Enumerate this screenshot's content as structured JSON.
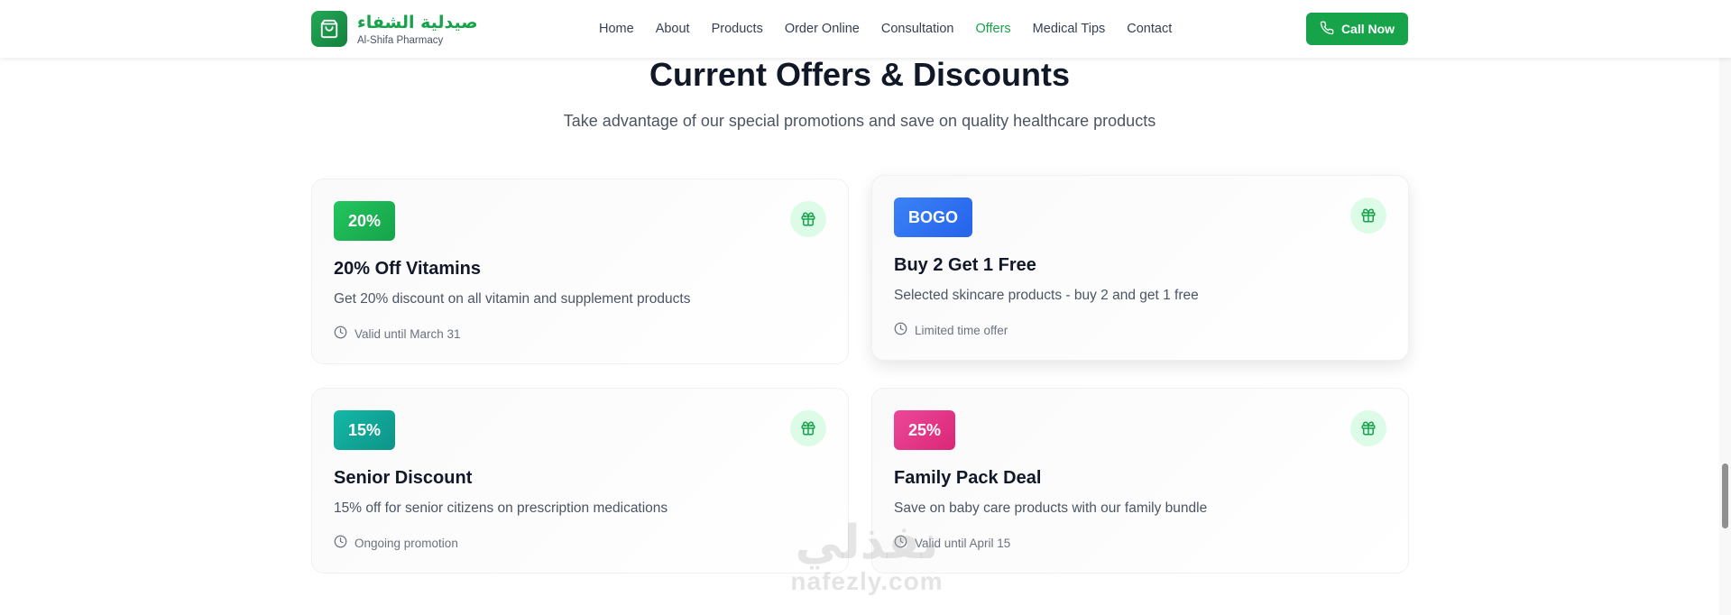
{
  "header": {
    "brand_arabic": "صيدلية الشفاء",
    "brand_english": "Al-Shifa Pharmacy",
    "nav": [
      {
        "label": "Home",
        "active": false
      },
      {
        "label": "About",
        "active": false
      },
      {
        "label": "Products",
        "active": false
      },
      {
        "label": "Order Online",
        "active": false
      },
      {
        "label": "Consultation",
        "active": false
      },
      {
        "label": "Offers",
        "active": true
      },
      {
        "label": "Medical Tips",
        "active": false
      },
      {
        "label": "Contact",
        "active": false
      }
    ],
    "call_button": "Call Now"
  },
  "section": {
    "title": "Current Offers & Discounts",
    "subtitle": "Take advantage of our special promotions and save on quality healthcare products"
  },
  "offers": [
    {
      "badge": "20%",
      "badge_color": "#16a34a",
      "title": "20% Off Vitamins",
      "description": "Get 20% discount on all vitamin and supplement products",
      "validity": "Valid until March 31"
    },
    {
      "badge": "BOGO",
      "badge_color": "#2563eb",
      "title": "Buy 2 Get 1 Free",
      "description": "Selected skincare products - buy 2 and get 1 free",
      "validity": "Limited time offer"
    },
    {
      "badge": "15%",
      "badge_color": "#0d9488",
      "title": "Senior Discount",
      "description": "15% off for senior citizens on prescription medications",
      "validity": "Ongoing promotion"
    },
    {
      "badge": "25%",
      "badge_color": "#db2777",
      "title": "Family Pack Deal",
      "description": "Save on baby care products with our family bundle",
      "validity": "Valid until April 15"
    }
  ],
  "watermark": {
    "arabic": "نفذلي",
    "english": "nafezly.com"
  },
  "icons": {
    "logo": "shopping-bag-icon",
    "call": "phone-icon",
    "offer": "gift-icon",
    "validity": "clock-icon"
  },
  "colors": {
    "brand": "#16a34a",
    "gift_bg": "#dcfce7"
  }
}
